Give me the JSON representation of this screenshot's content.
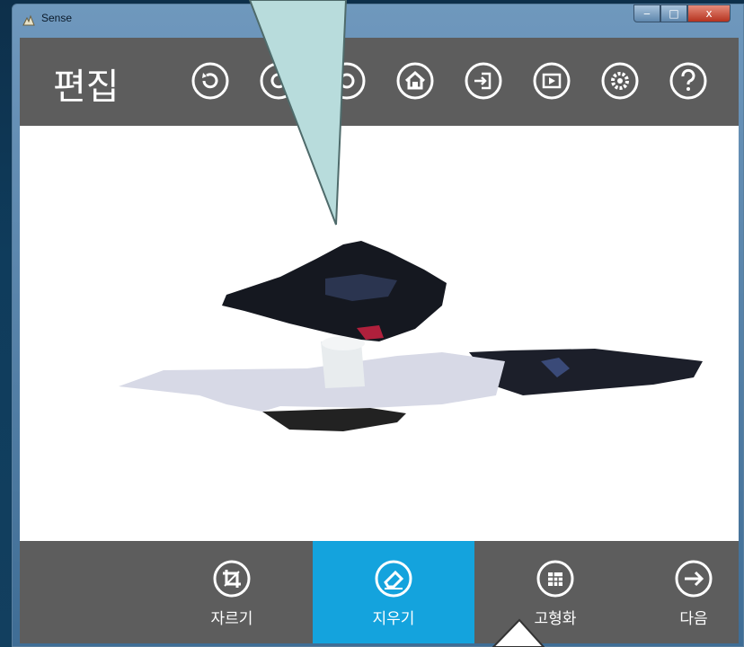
{
  "window": {
    "title": "Sense",
    "minimize_glyph": "‒",
    "maximize_glyph": "□",
    "close_glyph": "x"
  },
  "header": {
    "title": "편집"
  },
  "toolbar_icons": [
    "undo-icon",
    "redo-icon",
    "view-icon",
    "home-icon",
    "import-icon",
    "play-icon",
    "settings-icon",
    "help-icon"
  ],
  "tools": [
    {
      "label": "자르기",
      "icon": "crop-icon",
      "active": false
    },
    {
      "label": "지우기",
      "icon": "eraser-icon",
      "active": true
    },
    {
      "label": "고형화",
      "icon": "solidify-icon",
      "active": false
    },
    {
      "label": "다음",
      "icon": "next-arrow-icon",
      "active": false
    }
  ],
  "colors": {
    "accent": "#14a3dd",
    "bar": "#5d5d5d",
    "callout": "#b8dcdc"
  }
}
